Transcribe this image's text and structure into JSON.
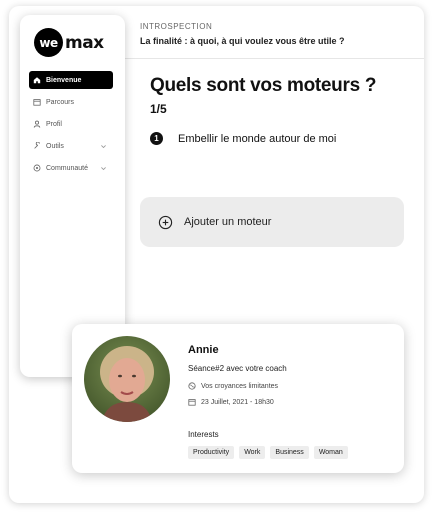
{
  "brand": {
    "logo_mark": "we",
    "logo_text": "max"
  },
  "sidebar": {
    "items": [
      {
        "label": "Bienvenue",
        "icon": "home-icon",
        "active": true
      },
      {
        "label": "Parcours",
        "icon": "calendar-icon"
      },
      {
        "label": "Profil",
        "icon": "user-icon"
      },
      {
        "label": "Outils",
        "icon": "tools-icon",
        "expandable": true
      },
      {
        "label": "Communauté",
        "icon": "community-icon",
        "expandable": true
      }
    ]
  },
  "header": {
    "section": "INTROSPECTION",
    "subtitle": "La finalité : à quoi, à qui voulez vous être utile ?"
  },
  "main": {
    "title": "Quels sont vos moteurs ?",
    "step": "1/5",
    "items": [
      {
        "number": "1",
        "text": "Embellir le monde autour de moi"
      }
    ],
    "add_button": "Ajouter un moteur"
  },
  "coach_card": {
    "name": "Annie",
    "session": "Séance#2 avec votre coach",
    "topic": "Vos croyances limitantes",
    "date": "23 Juillet, 2021 - 18h30",
    "interests_label": "Interests",
    "tags": [
      "Productivity",
      "Work",
      "Business",
      "Woman"
    ]
  }
}
